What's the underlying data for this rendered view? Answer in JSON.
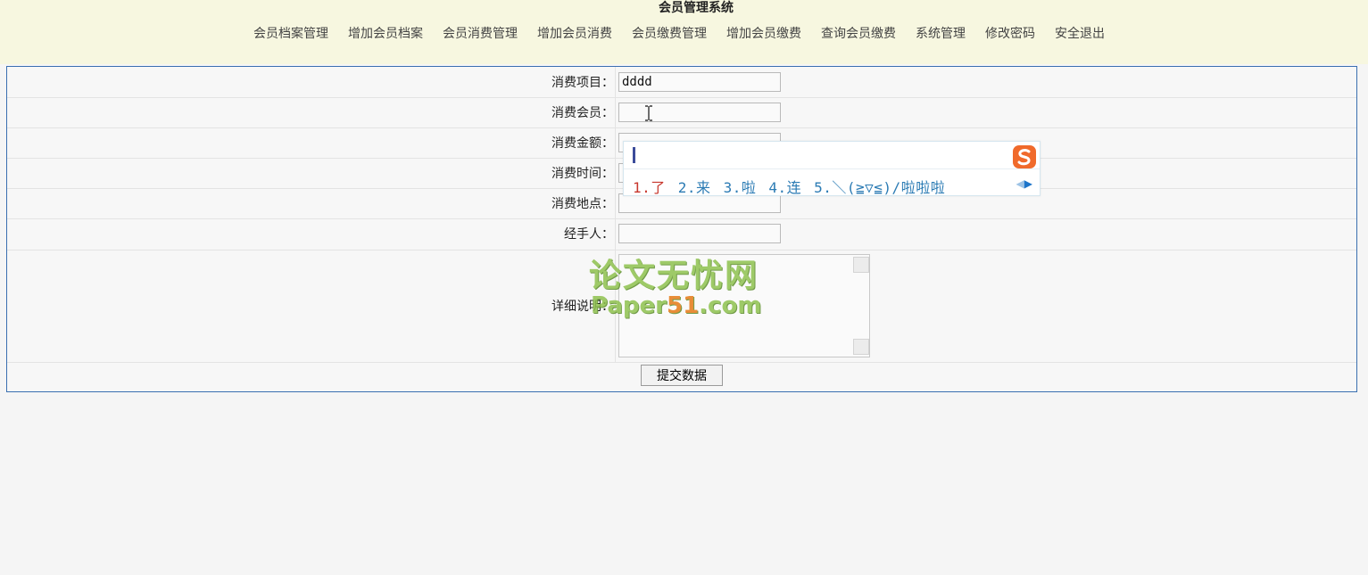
{
  "app": {
    "title": "会员管理系统"
  },
  "nav": {
    "items": [
      {
        "label": "会员档案管理"
      },
      {
        "label": "增加会员档案"
      },
      {
        "label": "会员消费管理"
      },
      {
        "label": "增加会员消费"
      },
      {
        "label": "会员缴费管理"
      },
      {
        "label": "增加会员缴费"
      },
      {
        "label": "查询会员缴费"
      },
      {
        "label": "系统管理"
      },
      {
        "label": "修改密码"
      },
      {
        "label": "安全退出"
      }
    ]
  },
  "form": {
    "fields": [
      {
        "label": "消费项目：",
        "value": "dddd"
      },
      {
        "label": "消费会员：",
        "value": ""
      },
      {
        "label": "消费金额：",
        "value": ""
      },
      {
        "label": "消费时间：",
        "value": ""
      },
      {
        "label": "消费地点：",
        "value": ""
      },
      {
        "label": "经手人：",
        "value": ""
      }
    ],
    "detail_label": "详细说明：",
    "submit_label": "提交数据"
  },
  "ime": {
    "candidates": [
      "1.了",
      "2.来",
      "3.啦",
      "4.连",
      "5.＼(≧▽≦)/啦啦啦"
    ],
    "logo": "S"
  },
  "watermark": {
    "cn": "论文无忧网",
    "en_prefix": "Paper",
    "en_highlight": "51",
    "en_suffix": ".com"
  },
  "colors": {
    "header_bg": "#f7f7e0",
    "frame_border": "#3a6fb0",
    "ime_candidate": "#2b7bb4",
    "ime_first": "#c8372d",
    "watermark": "#8fc24f"
  }
}
